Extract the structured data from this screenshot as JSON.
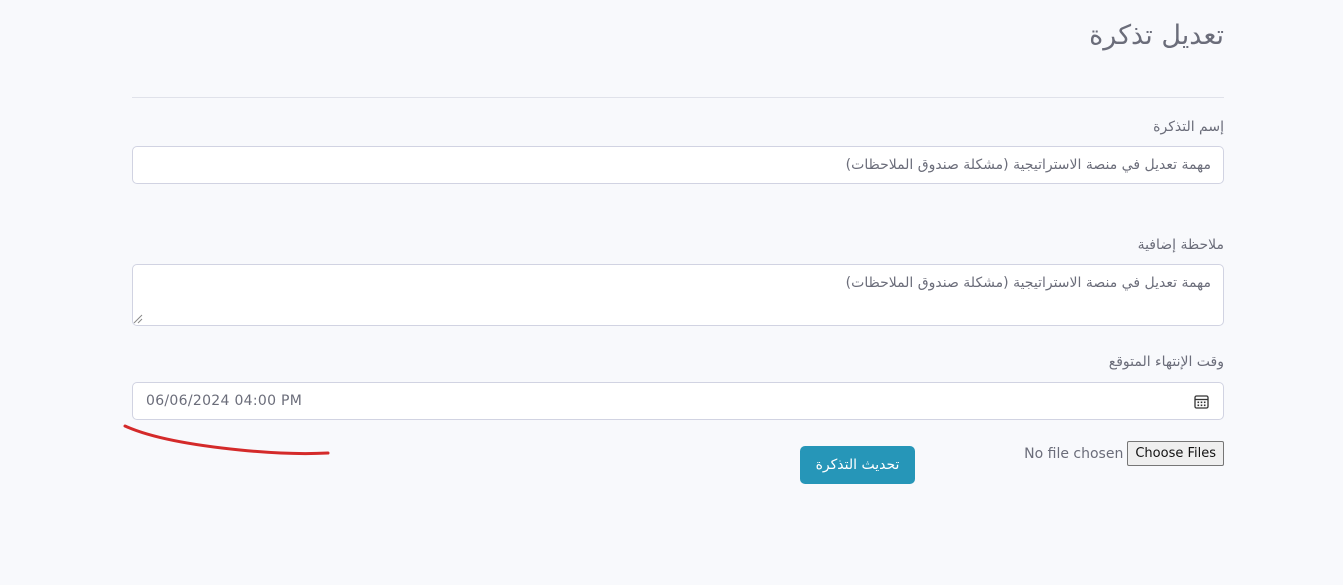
{
  "page": {
    "title": "تعديل تذكرة"
  },
  "form": {
    "name_label": "إسم التذكرة",
    "name_value": "مهمة تعديل في منصة الاستراتيجية (مشكلة صندوق الملاحظات)",
    "note_label": "ملاحظة إضافية",
    "note_value": "مهمة تعديل في منصة الاستراتيجية (مشكلة صندوق الملاحظات)",
    "deadline_label": "وقت الإنتهاء المتوقع",
    "deadline_value": "06/06/2024 04:00 PM",
    "deadline_icon": "calendar-icon",
    "file_status": "No file chosen",
    "choose_files_label": "Choose Files",
    "submit_label": "تحديث التذكرة"
  },
  "colors": {
    "background": "#f8f9fc",
    "accent": "#2696b8",
    "annotation": "#d42a2a"
  }
}
